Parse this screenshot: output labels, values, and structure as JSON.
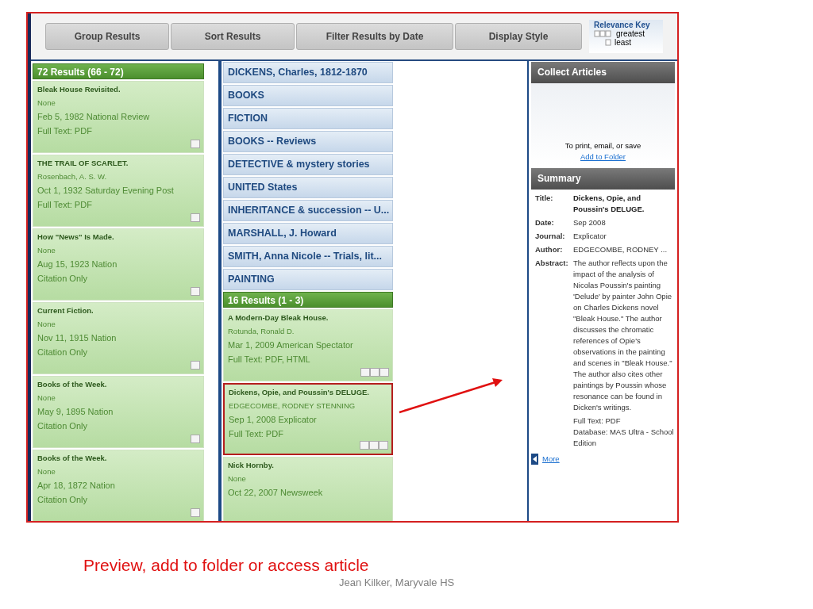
{
  "toolbar": {
    "buttons": [
      "Group Results",
      "Sort Results",
      "Filter Results by Date",
      "Display Style"
    ],
    "relevance_key": {
      "title": "Relevance Key",
      "greatest": "greatest",
      "least": "least"
    }
  },
  "left_results": {
    "header": "72 Results (66 - 72)",
    "cards": [
      {
        "title": "Bleak House Revisited.",
        "author": "None",
        "source": "Feb 5, 1982 National Review",
        "access": "Full Text: PDF",
        "kind": "low",
        "selected": false
      },
      {
        "title": "THE TRAIL OF SCARLET.",
        "author": "Rosenbach, A. S. W.",
        "source": "Oct 1, 1932 Saturday Evening Post",
        "access": "Full Text: PDF",
        "kind": "low",
        "selected": false
      },
      {
        "title": "How \"News\" Is Made.",
        "author": "None",
        "source": "Aug 15, 1923 Nation",
        "access": "Citation Only",
        "kind": "low",
        "selected": false
      },
      {
        "title": "Current Fiction.",
        "author": "None",
        "source": "Nov 11, 1915 Nation",
        "access": "Citation Only",
        "kind": "low",
        "selected": false
      },
      {
        "title": "Books of the Week.",
        "author": "None",
        "source": "May 9, 1895 Nation",
        "access": "Citation Only",
        "kind": "low",
        "selected": false
      },
      {
        "title": "Books of the Week.",
        "author": "None",
        "source": "Apr 18, 1872 Nation",
        "access": "Citation Only",
        "kind": "low",
        "selected": false
      }
    ]
  },
  "subjects": [
    "DICKENS, Charles, 1812-1870",
    "BOOKS",
    "FICTION",
    "BOOKS -- Reviews",
    "DETECTIVE & mystery stories",
    "UNITED States",
    "INHERITANCE & succession -- U...",
    "MARSHALL, J. Howard",
    "SMITH, Anna Nicole -- Trials, lit...",
    "PAINTING"
  ],
  "middle_results": {
    "header": "16 Results (1 - 3)",
    "cards": [
      {
        "title": "A Modern-Day Bleak House.",
        "author": "Rotunda, Ronald D.",
        "source": "Mar 1, 2009 American Spectator",
        "access": "Full Text: PDF, HTML",
        "kind": "high",
        "selected": false
      },
      {
        "title": "Dickens, Opie, and Poussin's DELUGE.",
        "author": "EDGECOMBE, RODNEY STENNING",
        "source": "Sep 1, 2008 Explicator",
        "access": "Full Text: PDF",
        "kind": "high",
        "selected": true
      },
      {
        "title": "Nick Hornby.",
        "author": "None",
        "source": "Oct 22, 2007 Newsweek",
        "selected": false
      }
    ]
  },
  "collect": {
    "header": "Collect Articles",
    "text": "To print, email, or save",
    "link": "Add to Folder"
  },
  "summary": {
    "header": "Summary",
    "fields": [
      {
        "label": "Title:",
        "value": "Dickens, Opie, and Poussin's DELUGE.",
        "kind": "bold"
      },
      {
        "label": "Date:",
        "value": "Sep 2008",
        "kind": "plain"
      },
      {
        "label": "Journal:",
        "value": "Explicator",
        "kind": "plain"
      },
      {
        "label": "Author:",
        "value": "EDGECOMBE, RODNEY ...",
        "kind": "plain"
      },
      {
        "label": "Abstract:",
        "value": "The author reflects upon the impact of the analysis of Nicolas Poussin's painting 'Delude' by painter John Opie on Charles Dickens novel \"Bleak House.\" The author discusses the chromatic references of Opie's observations in the painting and scenes in \"Bleak House.\" The author also cites other paintings by Poussin whose resonance can be found in Dicken's writings.",
        "kind": "plain"
      }
    ],
    "extra": [
      "Full Text: PDF",
      "Database: MAS Ultra - School Edition"
    ],
    "more": "More"
  },
  "slide": {
    "caption": "Preview, add to folder or access article",
    "credit": "Jean Kilker, Maryvale HS"
  }
}
